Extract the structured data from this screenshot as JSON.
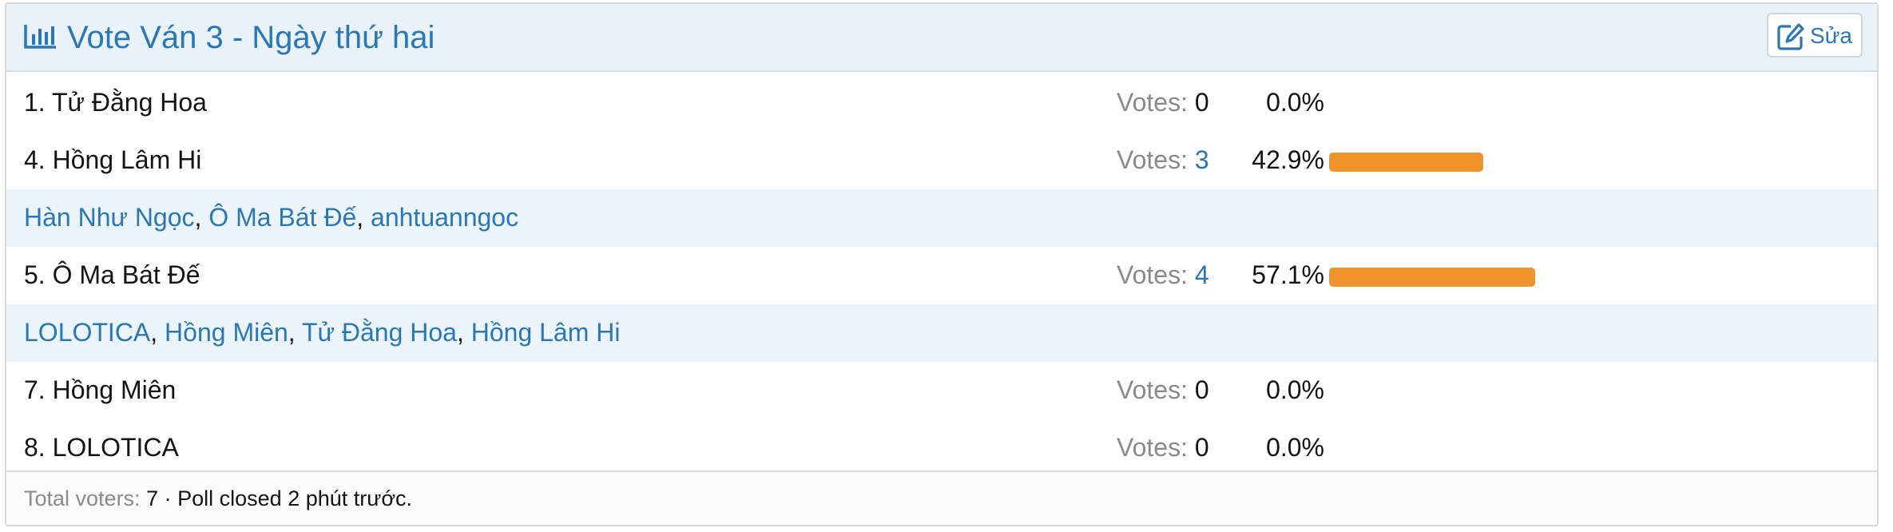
{
  "poll": {
    "title": "Vote Ván 3 - Ngày thứ hai",
    "edit_label": "Sửa",
    "icons": {
      "title": "bar-chart-icon",
      "edit": "edit-icon"
    },
    "accent_color": "#2a77b4",
    "bar_color": "#f0932b",
    "votes_label": "Votes:",
    "options": [
      {
        "label": "1. Tử Đằng Hoa",
        "votes": "0",
        "percent": "0.0%",
        "fraction": 0.0
      },
      {
        "label": "4. Hồng Lâm Hi",
        "votes": "3",
        "percent": "42.9%",
        "fraction": 0.429,
        "voters": [
          "Hàn Như Ngọc",
          "Ô Ma Bát Đế",
          "anhtuanngoc"
        ]
      },
      {
        "label": "5. Ô Ma Bát Đế",
        "votes": "4",
        "percent": "57.1%",
        "fraction": 0.571,
        "voters": [
          "LOLOTICA",
          "Hồng Miên",
          "Tử Đằng Hoa",
          "Hồng Lâm Hi"
        ]
      },
      {
        "label": "7. Hồng Miên",
        "votes": "0",
        "percent": "0.0%",
        "fraction": 0.0
      },
      {
        "label": "8. LOLOTICA",
        "votes": "0",
        "percent": "0.0%",
        "fraction": 0.0
      }
    ],
    "footer": {
      "total_label": "Total voters:",
      "total_value": "7",
      "status": "· Poll closed 2 phút trước."
    }
  }
}
